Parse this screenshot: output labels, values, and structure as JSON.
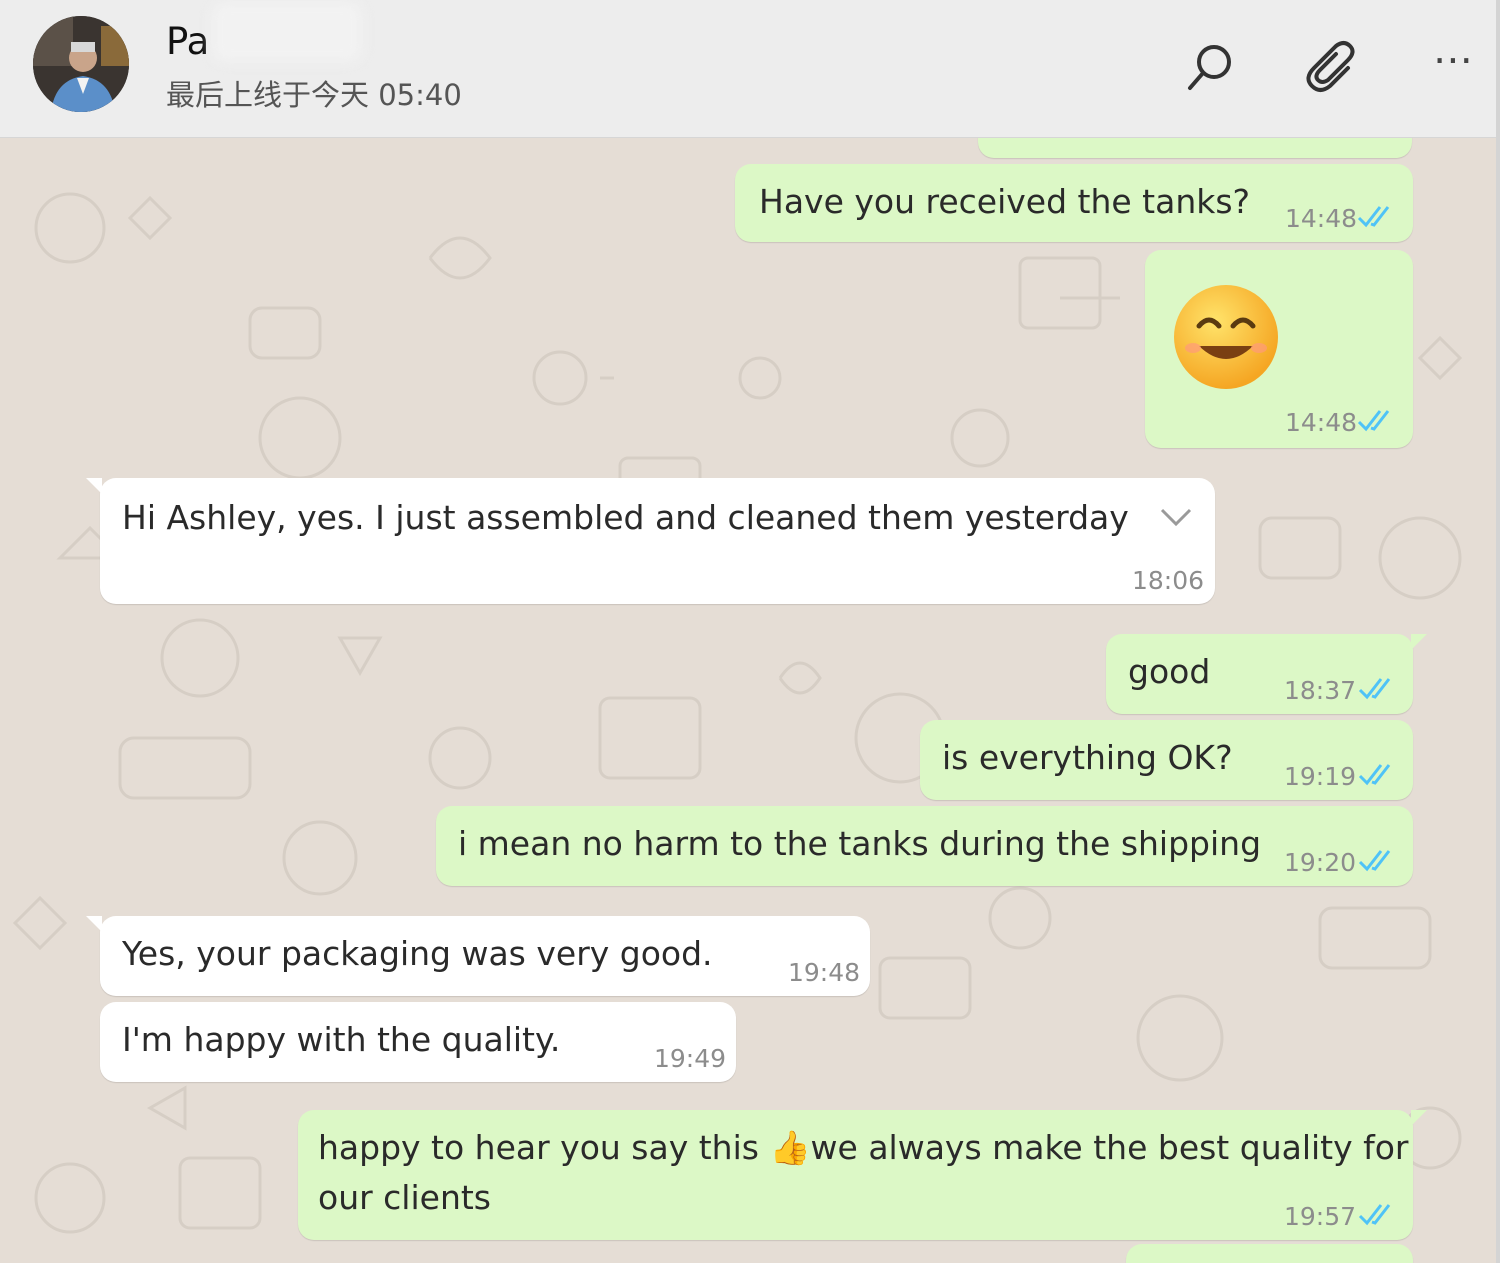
{
  "header": {
    "contact_name": "Pa",
    "last_seen": "最后上线于今天 05:40"
  },
  "colors": {
    "outgoing_bubble": "#dcf8c6",
    "incoming_bubble": "#ffffff",
    "chat_background": "#e5ddd5",
    "read_ticks": "#4fc3f7"
  },
  "messages": [
    {
      "direction": "out",
      "text": "Have you received the tanks?",
      "time": "14:48",
      "status": "read"
    },
    {
      "direction": "out",
      "emoji": "😊",
      "time": "14:48",
      "status": "read"
    },
    {
      "direction": "in",
      "text": "Hi Ashley, yes.  I just assembled and cleaned them yesterday",
      "time": "18:06"
    },
    {
      "direction": "out",
      "text": "good",
      "time": "18:37",
      "status": "read"
    },
    {
      "direction": "out",
      "text": "is everything OK?",
      "time": "19:19",
      "status": "read"
    },
    {
      "direction": "out",
      "text": "i mean no harm to the tanks during the shipping",
      "time": "19:20",
      "status": "read"
    },
    {
      "direction": "in",
      "text": "Yes, your packaging was very good.",
      "time": "19:48"
    },
    {
      "direction": "in",
      "text": "I'm happy with the quality.",
      "time": "19:49"
    },
    {
      "direction": "out",
      "text_line1_a": "happy to hear you say this ",
      "emoji": "👍",
      "text_line1_b": "we always make the best quality for",
      "text_line2": "our clients",
      "time": "19:57",
      "status": "read"
    }
  ]
}
